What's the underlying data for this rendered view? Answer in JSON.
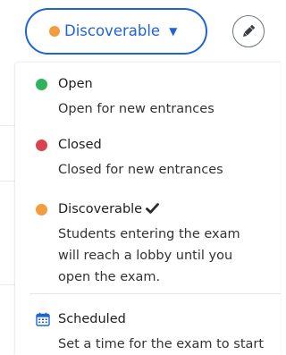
{
  "status_toggle": {
    "label": "Discoverable",
    "dot_color": "#f39c3c",
    "caret_icon": "caret-down-icon",
    "text_color": "#1f63d6",
    "border_color": "#1f63d6"
  },
  "edit_button": {
    "icon": "pencil-icon",
    "icon_color": "#3b3f44"
  },
  "menu": {
    "items": [
      {
        "title": "Open",
        "description": "Open for new entrances",
        "dot_color": "#2fb35d"
      },
      {
        "title": "Closed",
        "description": "Closed for new entrances",
        "dot_color": "#d9434e"
      },
      {
        "title": "Discoverable",
        "description": "Students entering the exam\nwill reach a lobby until you\nopen the exam.",
        "dot_color": "#f39c3c",
        "selected": true,
        "selected_icon": "checkmark-icon"
      },
      {
        "title": "Scheduled",
        "description": "Set a time for the exam to start",
        "icon": "calendar-icon",
        "icon_color": "#1f63d6"
      }
    ]
  }
}
